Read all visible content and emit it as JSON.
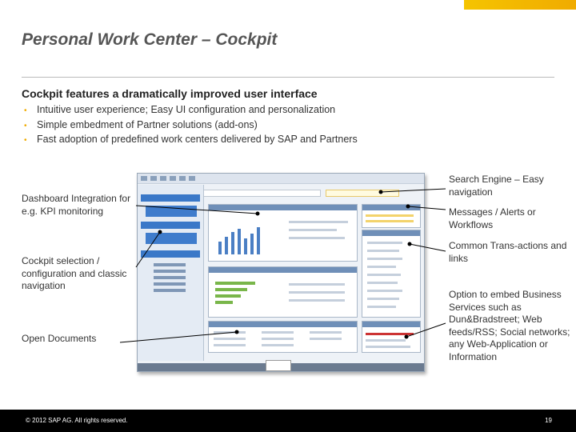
{
  "slide": {
    "title": "Personal Work Center – Cockpit",
    "subtitle": "Cockpit features a dramatically improved user interface",
    "bullets": [
      "Intuitive user experience; Easy UI configuration and personalization",
      "Simple embedment of Partner solutions (add-ons)",
      "Fast adoption of predefined work centers delivered by SAP and Partners"
    ]
  },
  "callouts_left": [
    "Dashboard Integration for e.g. KPI monitoring",
    "Cockpit selection / configuration and classic navigation",
    "Open Documents"
  ],
  "callouts_right": [
    "Search Engine – Easy navigation",
    "Messages / Alerts or Workflows",
    "Common Trans-actions and links",
    "Option to embed Business Services such as Dun&Bradstreet; Web feeds/RSS; Social networks; any Web-Application or Information"
  ],
  "footer": {
    "copyright": "© 2012 SAP AG. All rights reserved.",
    "page_number": "19"
  },
  "colors": {
    "accent": "#f0ab00",
    "footer_bg": "#000000"
  }
}
